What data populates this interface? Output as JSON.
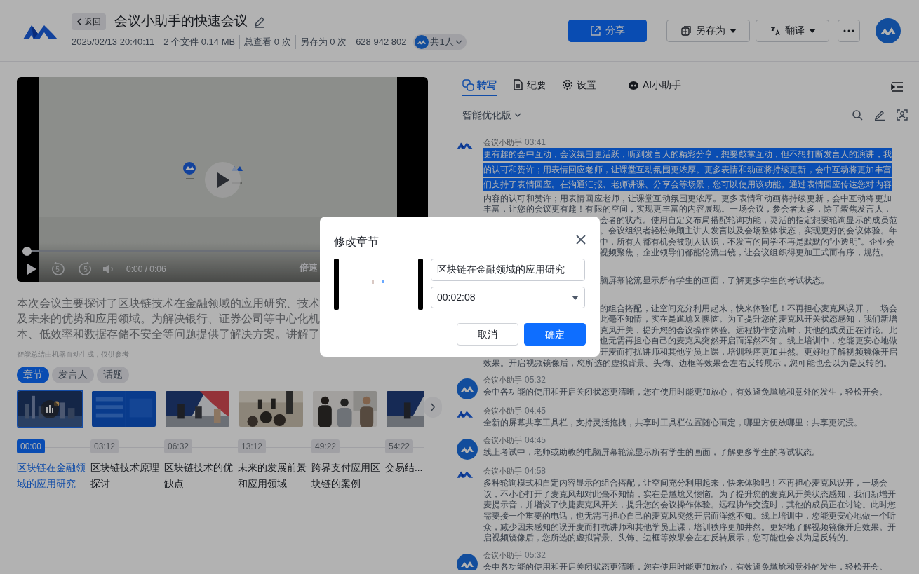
{
  "header": {
    "back": "返回",
    "title": "会议小助手的快速会议",
    "meta": [
      "2025/02/13 20:40:11",
      "2 个文件 0.14 MB",
      "总查看 0 次",
      "另存为 0 次",
      "628 942 802"
    ],
    "members": "共1人",
    "actions": [
      {
        "label": "分享",
        "kind": "primary"
      },
      {
        "label": "另存为",
        "kind": "dropdown"
      },
      {
        "label": "翻译",
        "kind": "dropdown"
      }
    ]
  },
  "video": {
    "rewind": "5",
    "forward": "5",
    "time": "0:00 / 0:06",
    "speed": "倍速",
    "level": 0
  },
  "summary": {
    "lines": [
      "本次会议主要探讨了区块链技术在金融领域的应用研究、技术",
      "及未来的优势和应用领域。为解决银行、证券公司等中心化机",
      "本、低效率和数据存储不安全等问题提供了解决方案。讲解了"
    ],
    "note": "智能总结由机器自动生成，仅供参考"
  },
  "chapter_tabs": [
    {
      "label": "章节",
      "selected": true
    },
    {
      "label": "发言人",
      "selected": false
    },
    {
      "label": "话题",
      "selected": false
    }
  ],
  "chapters": [
    {
      "time": "00:00",
      "title": "区块链在金融领域的应用研究",
      "selected": true
    },
    {
      "time": "03:12",
      "title": "区块链技术原理探讨",
      "selected": false
    },
    {
      "time": "06:32",
      "title": "区块链技术的优缺点",
      "selected": false
    },
    {
      "time": "13:12",
      "title": "未来的发展前景和应用领域",
      "selected": false
    },
    {
      "time": "49:22",
      "title": "跨界支付应用区块链的案例",
      "selected": false
    },
    {
      "time": "54:22",
      "title": "交易结...",
      "selected": false
    }
  ],
  "panel": {
    "tabs": [
      {
        "label": "转写",
        "selected": true
      },
      {
        "label": "纪要",
        "selected": false
      },
      {
        "label": "设置",
        "selected": false
      },
      {
        "label": "AI小助手",
        "selected": false
      }
    ],
    "version": "智能优化版"
  },
  "messages": [
    {
      "kind": "logo",
      "speaker": "会议小助手",
      "time": "03:41",
      "lines": [
        {
          "text": "更有趣的会中互动，会议氛围更活跃，听到发言人的精彩分享，想要鼓掌互动，但不想打断发言人的演讲，我",
          "selected": true,
          "kind": "line"
        },
        {
          "text": "的认可和赞许；用表情回应老师，让课堂互动氛围更浓厚。更多表情和动画将持续更新，会中互动将更加丰富",
          "selected": true,
          "kind": "line"
        },
        {
          "text": "们支持了表情回应。在沟通汇报、老师讲课、分享会等场景，您可以使用该功能。通过表情回应传达您对内容",
          "selected": true,
          "kind": "line"
        },
        {
          "text": "内容的认可和赞许；用表情回应老师，让课堂互动氛围更浓厚。更多表情和动画将持续更新，会中互动将更加",
          "selected": false,
          "kind": "line"
        },
        {
          "text": "丰富，让您的会议更有趣！有限的空间，实现更丰富的内容展现。一场会议，参会者太多，除了聚焦发言人，",
          "selected": false,
          "kind": "line"
        },
        {
          "text": "会者的状态。使用自定义布局搭配轮询功能，灵活的指定想要轮询显示的成员范",
          "selected": false,
          "kind": "fragment"
        },
        {
          "text": "。会议组织者轻松兼顾主讲人发言以及会场整体状态，实现更好的会议体验。年",
          "selected": false,
          "kind": "fragment"
        },
        {
          "text": "中，所有人都有机会被别人认识，不发言的同学不再是默默的“小透明”。企业会",
          "selected": false,
          "kind": "fragment"
        },
        {
          "text": "视频聚焦，企业领导们都能轮流出镜，让会议组织得更加正式而有序，规范。",
          "selected": false,
          "kind": "fragment"
        }
      ]
    },
    {
      "lines": [
        {
          "text": "脑屏幕轮流显示所有学生的画面，了解更多学生的考试状态。",
          "selected": false,
          "kind": "fragment"
        }
      ]
    },
    {
      "lines": [
        {
          "text": "的组合搭配，让空间充分利用起来，快来体验吧！不再担心麦克风误开，一场会",
          "selected": false,
          "kind": "fragment"
        },
        {
          "text": "此毫不知情，实在是尴尬又懊恼。为了提升您的麦克风开关状态感知，我们新增",
          "selected": false,
          "kind": "fragment"
        },
        {
          "text": "克风开关，提升您的会议操作体验。远程协作交流时，其他的成员正在讨论。此",
          "selected": false,
          "kind": "fragment"
        },
        {
          "text": "也无需再担心自己的麦克风突然开启而浑然不知。线上培训中，您能更安心地做",
          "selected": false,
          "kind": "fragment"
        },
        {
          "text": "开麦而打扰讲师和其他学员上课，培训秩序更加井然。更好地了解视频镜像开启",
          "selected": false,
          "kind": "fragment"
        },
        {
          "text": "效果。开启视频镜像后，您所选的虚拟背景、头饰、边框等效果会左右反转展示，您可能也会以为是反转的。",
          "selected": false,
          "kind": "line"
        }
      ]
    },
    {
      "kind": "round",
      "speaker": "会议小助手",
      "time": "05:32",
      "text": "会中各功能的使用和开启关闭状态更清晰，您在使用时能更加放心，有效避免尴尬和意外的发生，轻松开会。"
    },
    {
      "kind": "logo",
      "speaker": "会议小助手",
      "time": "04:45",
      "text": "全新的屏幕共享工具栏，支持灵活拖拽，共享时工具栏位置随心而定，哪里方便放哪里；共享更沉浸。"
    },
    {
      "kind": "round",
      "speaker": "会议小助手",
      "time": "04:45",
      "text": "线上考试中，老师或助教的电脑屏幕轮流显示所有学生的画面，了解更多学生的考试状态。"
    },
    {
      "kind": "logo",
      "speaker": "会议小助手",
      "time": "04:58",
      "text": "多种轮询模式和自定内容显示的组合搭配，让空间充分利用起来，快来体验吧！不再担心麦克风误开，一场会议，不小心打开了麦克风却对此毫不知情，实在是尴尬又懊恼。为了提升您的麦克风开关状态感知，我们新增开麦提示音，并增设了快捷麦克风开关，提升您的会议操作体验。远程协作交流时，其他的成员正在讨论。此时您需要接一个重要的电话，也无需再担心自己的麦克风突然开启而浑然不知。线上培训中，您能更安心地做一个听众，减少因未感知的误开麦而打扰讲师和其他学员上课，培训秩序更加井然。更好地了解视频镜像开启效果。开启视频镜像后，您所选的虚拟背景、头饰、边框等效果会左右反转展示，您可能也会以为是反转的。"
    },
    {
      "kind": "round",
      "speaker": "会议小助手",
      "time": "05:32",
      "text": "会中各功能的使用和开启关闭状态更清晰，您在使用时能更加放心，有效避免尴尬和意外的发生，轻松开会。"
    }
  ],
  "modal": {
    "title": "修改章节",
    "name_value": "区块链在金融领域的应用研究",
    "time_value": "00:02:08",
    "buttons": [
      {
        "label": "取消",
        "kind": "secondary"
      },
      {
        "label": "确定",
        "kind": "primary"
      }
    ]
  }
}
